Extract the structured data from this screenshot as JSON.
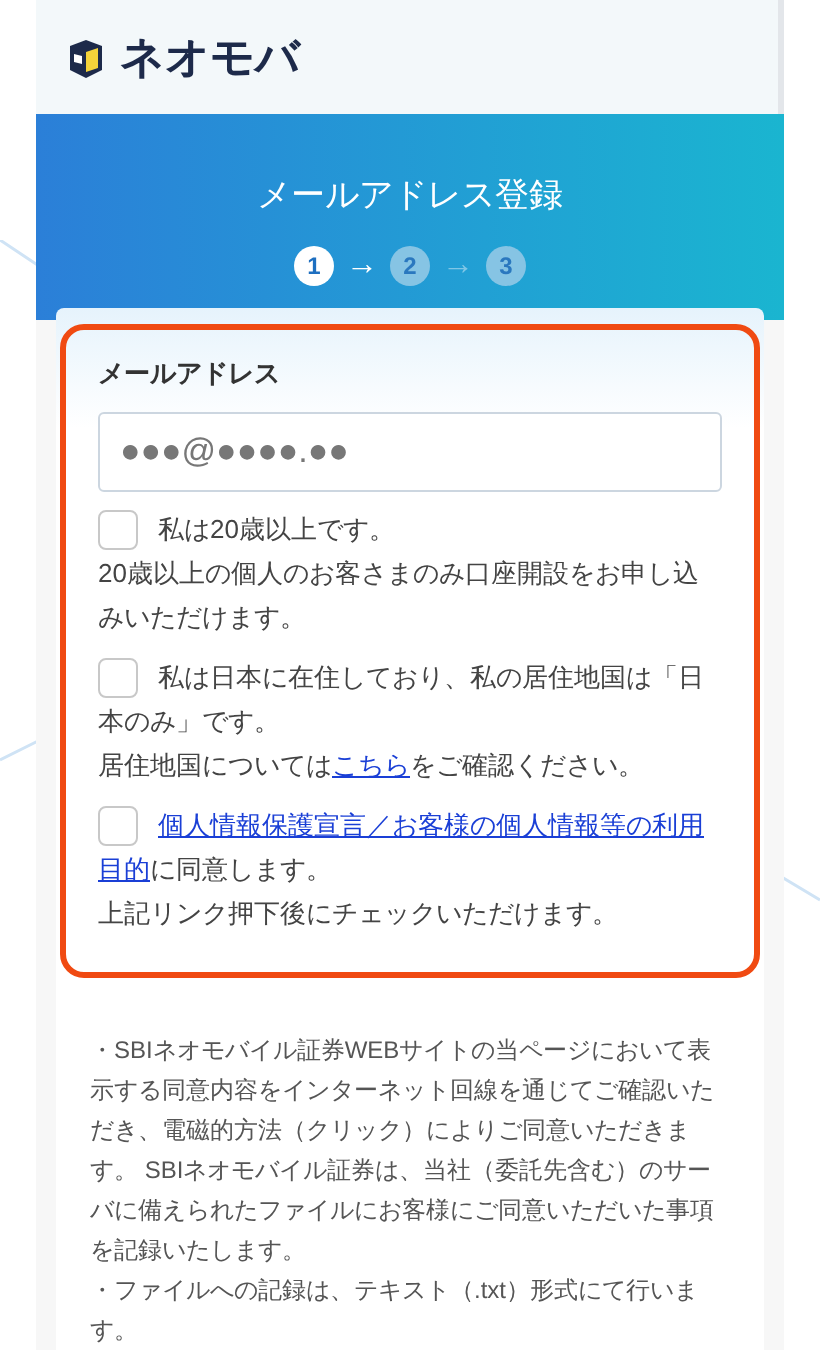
{
  "header": {
    "logo_text": "ネオモバ"
  },
  "banner": {
    "title": "メールアドレス登録",
    "steps": [
      {
        "label": "1",
        "selected": true
      },
      {
        "label": "2",
        "selected": false
      },
      {
        "label": "3",
        "selected": false
      }
    ],
    "arrows": [
      {
        "text": "→",
        "active": true
      },
      {
        "text": "→",
        "active": false
      }
    ]
  },
  "form": {
    "email_label": "メールアドレス",
    "email_value": "●●●@●●●●.●●",
    "checkboxes": [
      {
        "checked": false,
        "label": [
          [
            {
              "kind": "text",
              "text": "私は20歳以上です。"
            }
          ]
        ],
        "note": [
          {
            "kind": "text",
            "text": "20歳以上の個人のお客さまのみ口座開設をお申し込みいただけます。"
          }
        ]
      },
      {
        "checked": false,
        "label": [
          [
            {
              "kind": "text",
              "text": "私は日本に在住しており、私の居住地国は「日"
            }
          ],
          [
            {
              "kind": "text",
              "text": "本のみ」です。"
            }
          ]
        ],
        "note": [
          {
            "kind": "text",
            "text": "居住地国については"
          },
          {
            "kind": "link",
            "text": "こちら"
          },
          {
            "kind": "text",
            "text": "をご確認ください。"
          }
        ]
      },
      {
        "checked": false,
        "label": [
          [
            {
              "kind": "link",
              "text": "個人情報保護宣言／お客様の個人情報等の利用"
            }
          ],
          [
            {
              "kind": "link",
              "text": "目的"
            },
            {
              "kind": "text",
              "text": "に同意します。"
            }
          ]
        ],
        "note": [
          {
            "kind": "text",
            "text": "上記リンク押下後にチェックいただけます。"
          }
        ]
      }
    ]
  },
  "notes": [
    "・SBIネオモバイル証券WEBサイトの当ページにおいて表示する同意内容をインターネット回線を通じてご確認いただき、電磁的方法（クリック）によりご同意いただきます。 SBIネオモバイル証券は、当社（委託先含む）のサーバに備えられたファイルにお客様にご同意いただいた事項を記録いたします。",
    "・ファイルへの記録は、テキスト（.txt）形式にて行います。"
  ]
}
